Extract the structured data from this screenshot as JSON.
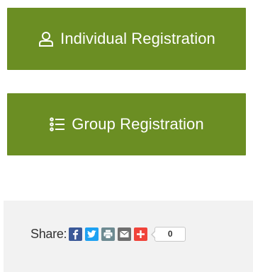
{
  "colors": {
    "button_bg": "#6b8e23",
    "facebook": "#3b5998",
    "twitter": "#1da1f2",
    "print": "#6d8a91",
    "email": "#6f6f6f",
    "more": "#f0433a"
  },
  "buttons": {
    "individual": {
      "label": "Individual Registration",
      "icon": "user-icon"
    },
    "group": {
      "label": "Group Registration",
      "icon": "list-icon"
    }
  },
  "share": {
    "label": "Share:",
    "icons": [
      "facebook-icon",
      "twitter-icon",
      "print-icon",
      "email-icon",
      "plus-icon"
    ],
    "count": "0"
  }
}
